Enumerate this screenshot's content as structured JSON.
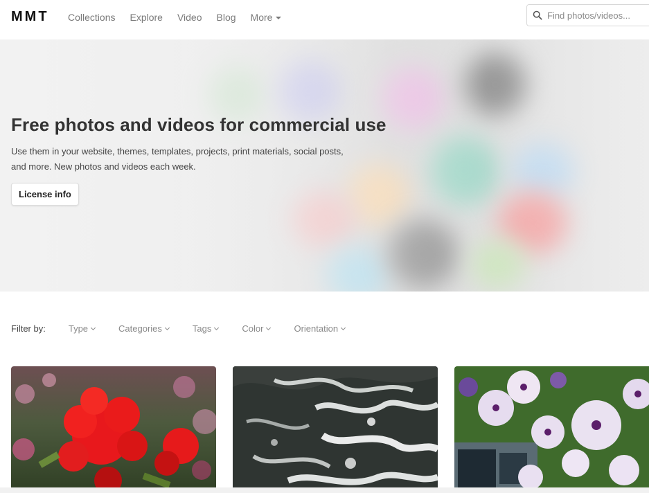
{
  "header": {
    "logo": "MMT",
    "nav": [
      {
        "label": "Collections"
      },
      {
        "label": "Explore"
      },
      {
        "label": "Video"
      },
      {
        "label": "Blog"
      },
      {
        "label": "More",
        "dropdown": true
      }
    ],
    "search": {
      "placeholder": "Find photos/videos..."
    }
  },
  "hero": {
    "title": "Free photos and videos for commercial use",
    "description": "Use them in your website, themes, templates, projects, print materials, social posts, and more. New photos and videos each week.",
    "license_button": "License info"
  },
  "filters": {
    "label": "Filter by:",
    "items": [
      {
        "label": "Type"
      },
      {
        "label": "Categories"
      },
      {
        "label": "Tags"
      },
      {
        "label": "Color"
      },
      {
        "label": "Orientation"
      }
    ]
  },
  "photos": [
    {
      "subject": "red-flowers"
    },
    {
      "subject": "ocean-waves"
    },
    {
      "subject": "purple-petunias"
    }
  ],
  "colors": {
    "logo": "#111111",
    "nav_text": "#7a7a7a",
    "hero_title": "#333333",
    "filter_text": "#8a8a8a"
  },
  "icons": {
    "search": "search-icon",
    "dropdown": "caret-down-icon",
    "chevron": "chevron-down-icon"
  }
}
